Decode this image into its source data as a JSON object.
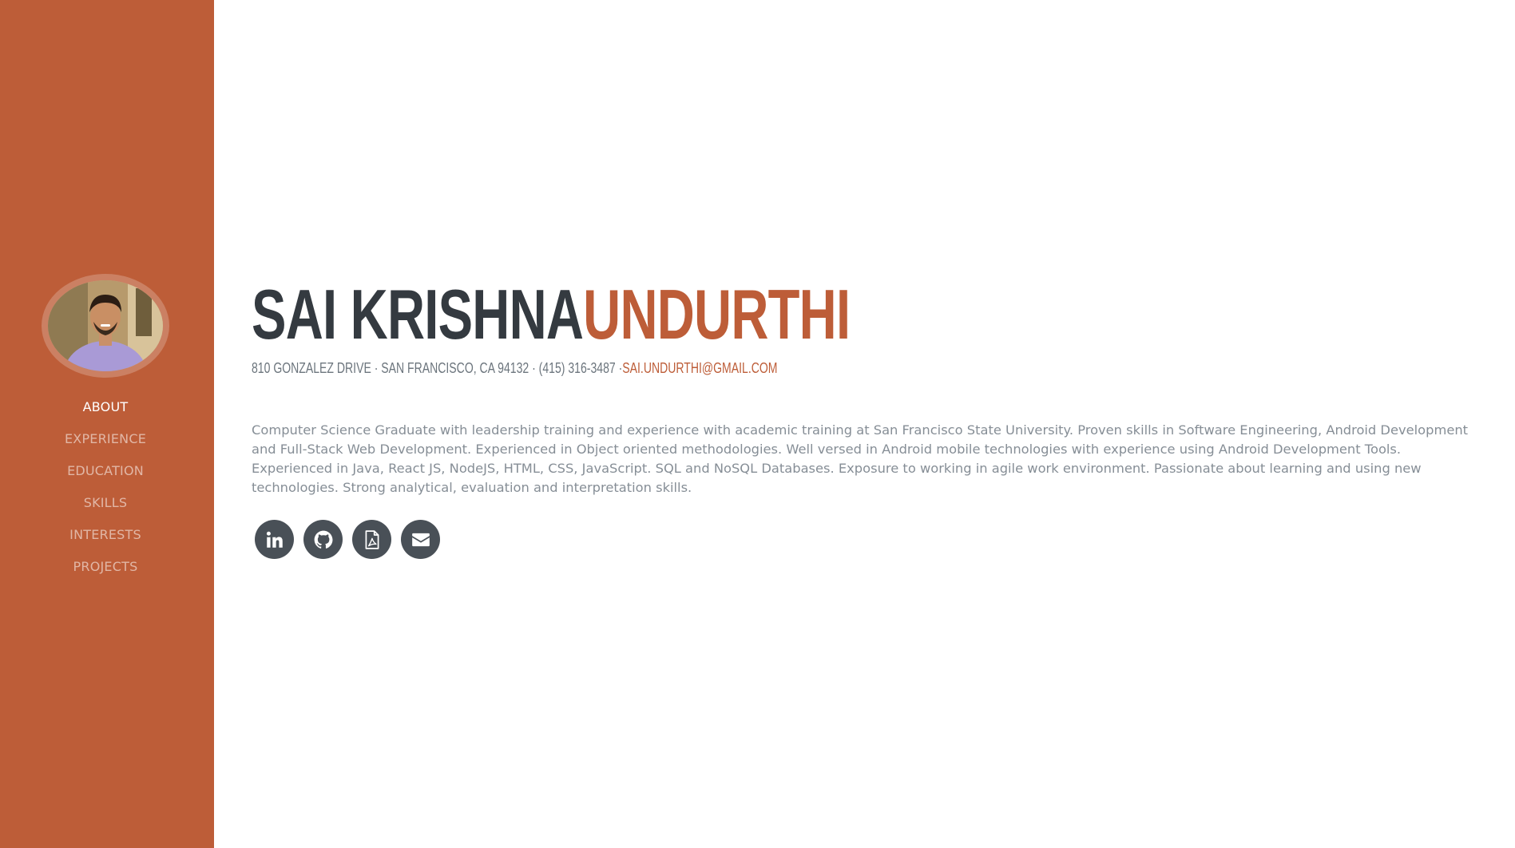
{
  "sidebar": {
    "nav": [
      {
        "label": "About",
        "active": true
      },
      {
        "label": "Experience",
        "active": false
      },
      {
        "label": "Education",
        "active": false
      },
      {
        "label": "Skills",
        "active": false
      },
      {
        "label": "Interests",
        "active": false
      },
      {
        "label": "Projects",
        "active": false
      }
    ]
  },
  "about": {
    "first_name": "Sai Krishna",
    "last_name": "Undurthi",
    "address": "810 Gonzalez Drive · San Francisco, CA 94132 · (415) 316-3487 ·",
    "email": "sai.undurthi@gmail.com",
    "summary": "Computer Science Graduate with leadership training and experience with academic training at San Francisco State University. Proven skills in Software Engineering, Android Development and Full-Stack Web Development. Experienced in Object oriented methodologies. Well versed in Android mobile technologies with experience using Android Development Tools. Experienced in Java, React JS, NodeJS, HTML, CSS, JavaScript. SQL and NoSQL Databases. Exposure to working in agile work environment. Passionate about learning and using new technologies. Strong analytical, evaluation and interpretation skills.",
    "social_icons": [
      "linkedin-icon",
      "github-icon",
      "pdf-icon",
      "envelope-icon"
    ]
  },
  "colors": {
    "primary": "#bd5d38",
    "dark": "#343a40",
    "icon_bg": "#495057",
    "text_muted": "#868e96"
  }
}
